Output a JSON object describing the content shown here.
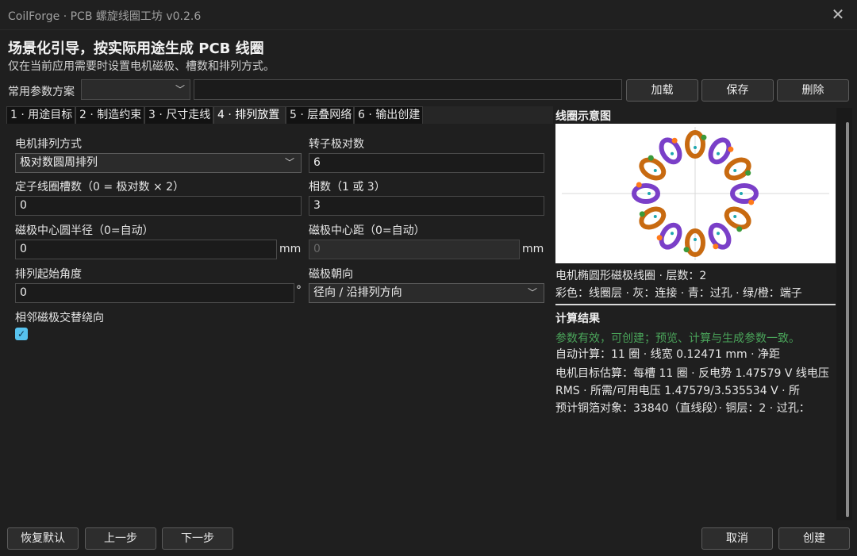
{
  "window": {
    "title": "CoilForge · PCB 螺旋线圈工坊 v0.2.6"
  },
  "header": {
    "title": "场景化引导，按实际用途生成 PCB 线圈",
    "subtitle": "仅在当前应用需要时设置电机磁极、槽数和排列方式。"
  },
  "preset": {
    "label": "常用参数方案",
    "selected": "",
    "name_value": "",
    "load": "加载",
    "save": "保存",
    "delete": "删除"
  },
  "tabs": [
    {
      "label": "1 · 用途目标"
    },
    {
      "label": "2 · 制造约束"
    },
    {
      "label": "3 · 尺寸走线"
    },
    {
      "label": "4 · 排列放置"
    },
    {
      "label": "5 · 层叠网络"
    },
    {
      "label": "6 · 输出创建"
    }
  ],
  "form": {
    "arrangement_label": "电机排列方式",
    "arrangement_value": "极对数圆周排列",
    "rotor_pairs_label": "转子极对数",
    "rotor_pairs_value": "6",
    "slots_label": "定子线圈槽数（0 = 极对数 × 2）",
    "slots_value": "0",
    "phases_label": "相数（1 或 3）",
    "phases_value": "3",
    "radius_label": "磁极中心圆半径（0=自动）",
    "radius_value": "0",
    "radius_unit": "mm",
    "pitch_label": "磁极中心距（0=自动）",
    "pitch_value": "0",
    "pitch_unit": "mm",
    "start_angle_label": "排列起始角度",
    "start_angle_value": "0",
    "start_angle_unit": "°",
    "orientation_label": "磁极朝向",
    "orientation_value": "径向 / 沿排列方向",
    "alternate_label": "相邻磁极交替绕向",
    "alternate_checked": true
  },
  "preview": {
    "title": "线圈示意图",
    "info_line1": "电机椭圆形磁极线圈 · 层数：2",
    "info_line2": "彩色：线圈层 · 灰：连接 · 青：过孔 · 绿/橙：端子",
    "coil_count": 12,
    "colors": {
      "layer_a": "#7a3fc8",
      "layer_b": "#c86a10",
      "via": "#1fa7b0",
      "term_green": "#3a9a3a",
      "term_orange": "#ff7a1a",
      "axis": "#d8d8d8"
    }
  },
  "results": {
    "title": "计算结果",
    "status": "参数有效，可创建；预览、计算与生成参数一致。",
    "line1": "自动计算：11 圈 · 线宽 0.12471 mm · 净距",
    "line2": "电机目标估算：每槽 11 圈 · 反电势 1.47579 V 线电压 RMS · 所需/可用电压 1.47579/3.535534 V · 所",
    "line3": "预计铜箔对象：33840（直线段）· 铜层：2 · 过孔："
  },
  "footer": {
    "reset": "恢复默认",
    "prev": "上一步",
    "next": "下一步",
    "cancel": "取消",
    "create": "创建"
  }
}
